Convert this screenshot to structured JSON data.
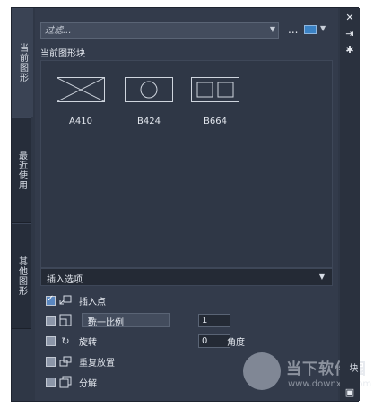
{
  "tabs": [
    {
      "label": "当前图形"
    },
    {
      "label": "最近使用"
    },
    {
      "label": "其他图形"
    }
  ],
  "filter": {
    "placeholder": "过滤..."
  },
  "toolbar": {
    "more_label": "..."
  },
  "current_section": {
    "title": "当前图形块"
  },
  "blocks": [
    {
      "label": "A410",
      "icon": "rect-with-cross"
    },
    {
      "label": "B424",
      "icon": "rect-with-circle"
    },
    {
      "label": "B664",
      "icon": "rect-with-two-squares"
    }
  ],
  "options": {
    "header": "插入选项",
    "insertion_point": {
      "label": "插入点",
      "checked": true
    },
    "scale": {
      "checked": false,
      "mode": "统一比例",
      "value": "1"
    },
    "rotation": {
      "label": "旋转",
      "checked": false,
      "value": "0",
      "angle_label": "角度"
    },
    "repeat": {
      "label": "重复放置",
      "checked": false
    },
    "explode": {
      "label": "分解",
      "checked": false
    }
  },
  "side_title": "块",
  "watermark": {
    "name": "当下软件园",
    "url": "www.downxia.com"
  },
  "colors": {
    "panel": "#333b4b",
    "accent": "#3b82c4"
  }
}
